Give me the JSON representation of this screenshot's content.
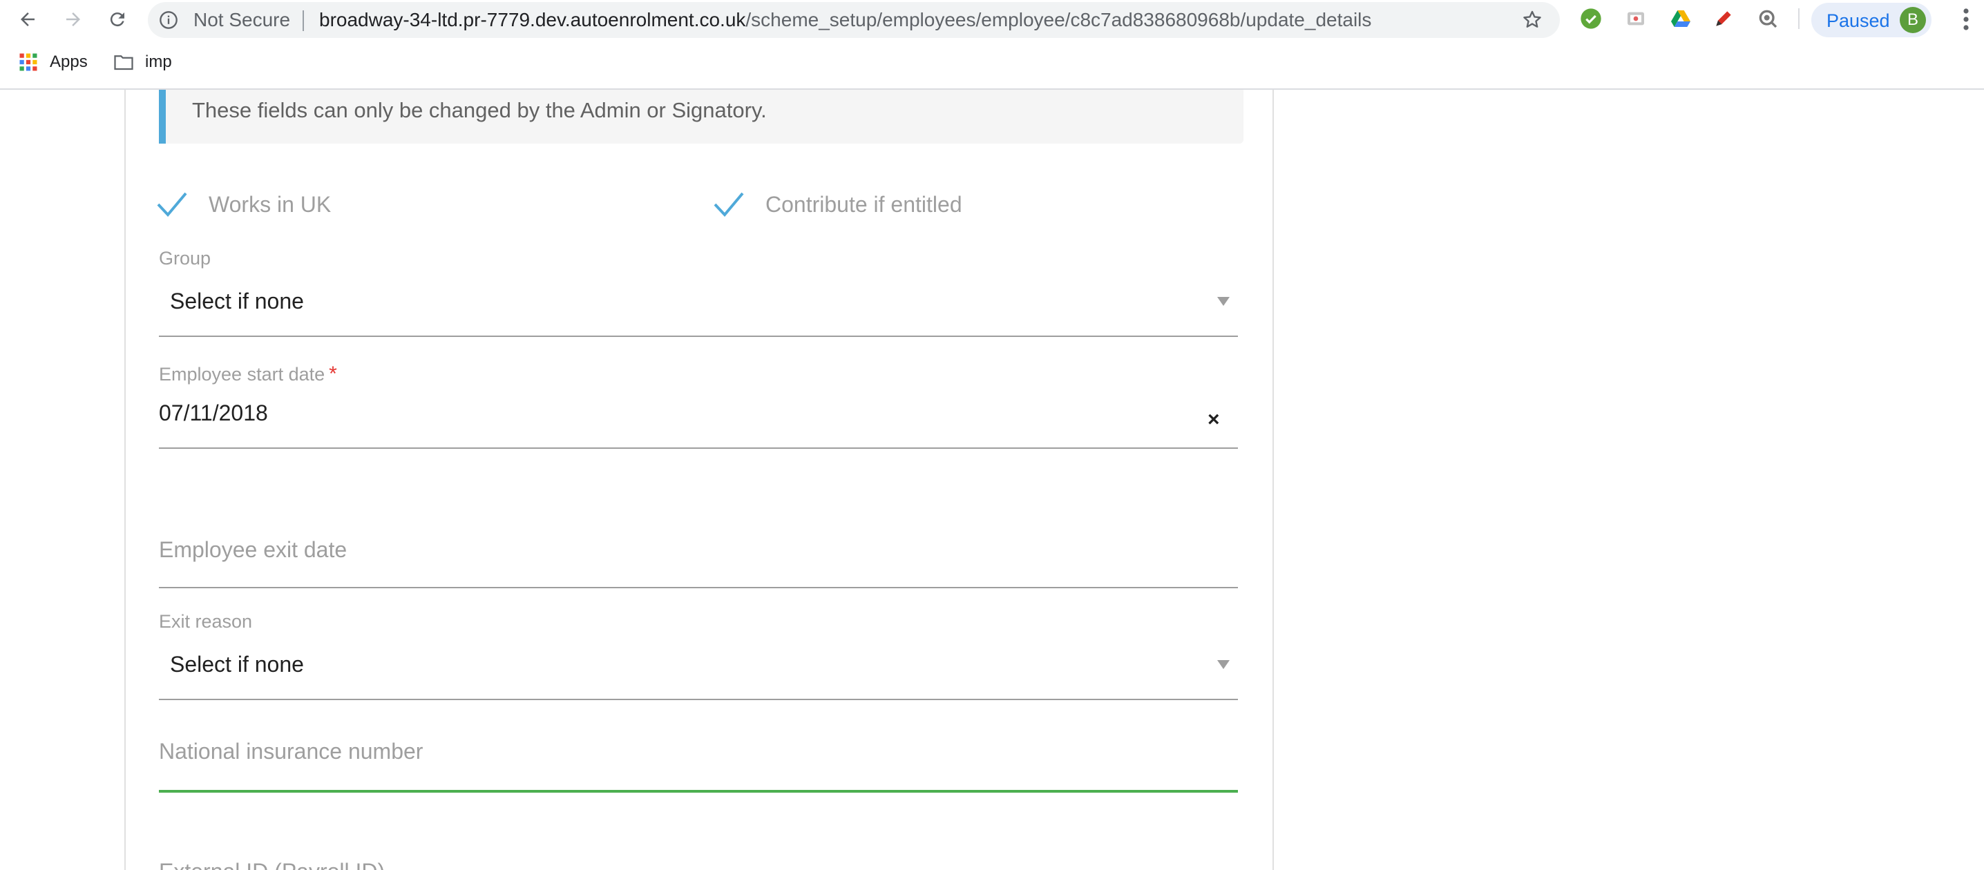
{
  "browser": {
    "security_label": "Not Secure",
    "url_host": "broadway-34-ltd.pr-7779.dev.autoenrolment.co.uk",
    "url_path": "/scheme_setup/employees/employee/c8c7ad838680968b/update_details",
    "profile_status": "Paused",
    "profile_initial": "B",
    "extension_icons": [
      "green-check-icon",
      "cast-icon",
      "google-drive-icon",
      "pen-icon",
      "search-extension-icon"
    ]
  },
  "bookmarks": [
    {
      "label": "Apps",
      "icon": "apps-grid-icon"
    },
    {
      "label": "imp",
      "icon": "folder-icon"
    }
  ],
  "form": {
    "notice_text": "These fields can only be changed by the Admin or Signatory.",
    "checkboxes": [
      {
        "label": "Works in UK",
        "checked": true
      },
      {
        "label": "Contribute if entitled",
        "checked": true
      }
    ],
    "group": {
      "label": "Group",
      "value": "Select if none"
    },
    "start_date": {
      "label": "Employee start date",
      "required_marker": "*",
      "value": "07/11/2018",
      "clear": "×"
    },
    "exit_date": {
      "placeholder": "Employee exit date"
    },
    "exit_reason": {
      "label": "Exit reason",
      "value": "Select if none"
    },
    "ni_number": {
      "placeholder": "National insurance number"
    },
    "external_id": {
      "placeholder": "External ID (Payroll ID)"
    }
  },
  "colors": {
    "accent_blue": "#4fa9d9",
    "active_green": "#4caf50",
    "required_red": "#e53935"
  }
}
